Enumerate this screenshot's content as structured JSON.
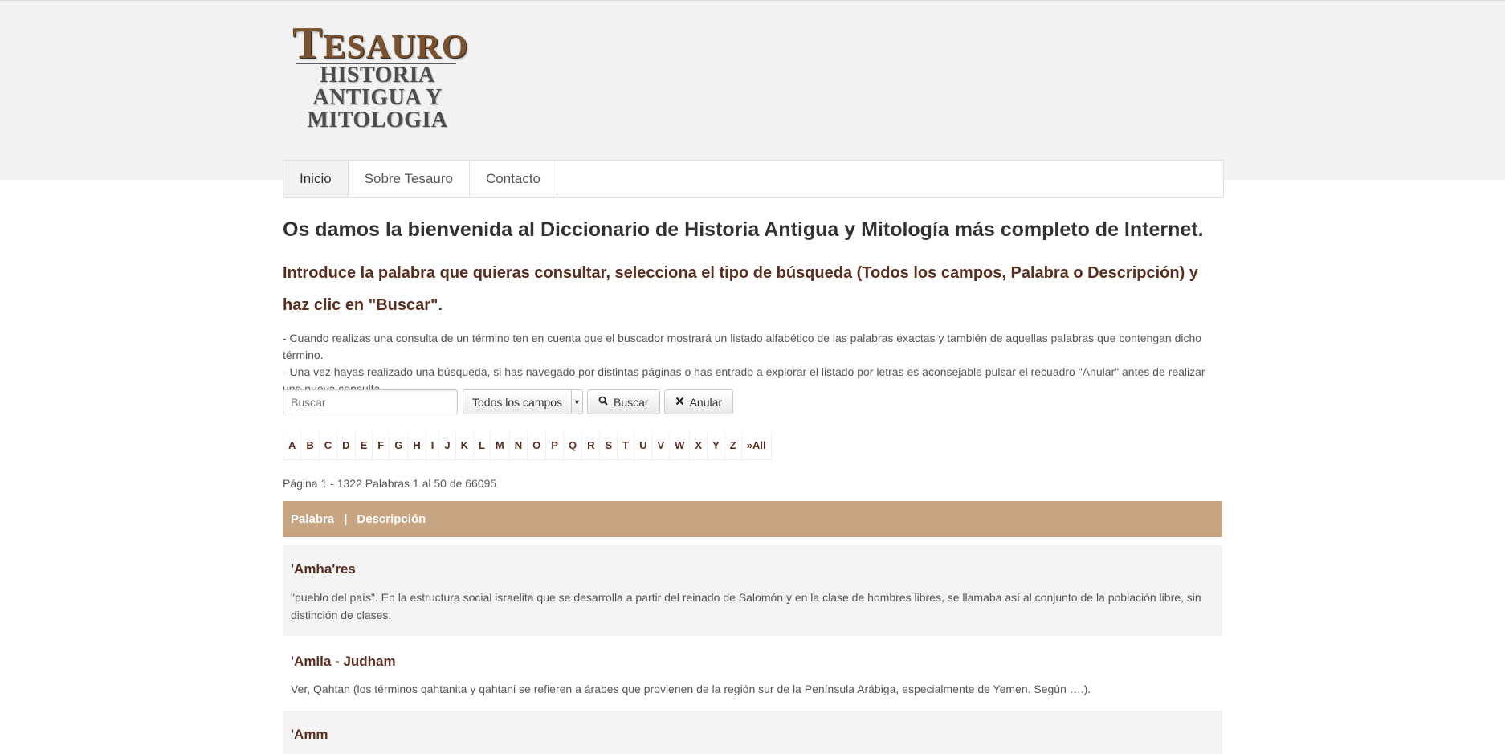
{
  "logo": {
    "line1_T": "T",
    "line1_rest": "ESAURO",
    "line2": "HISTORIA",
    "line3": "ANTIGUA Y",
    "line4": "MITOLOGIA"
  },
  "nav": {
    "items": [
      {
        "label": "Inicio"
      },
      {
        "label": "Sobre Tesauro"
      },
      {
        "label": "Contacto"
      }
    ]
  },
  "main": {
    "welcome": "Os damos la bienvenida al Diccionario de Historia Antigua y Mitología más completo de Internet.",
    "intro": "Introduce la palabra que quieras consultar, selecciona el tipo de búsqueda (Todos los campos, Palabra o Descripción) y haz clic en \"Buscar\".",
    "note1": "- Cuando realizas una consulta de un término ten en cuenta que el buscador mostrará un listado alfabético de las palabras exactas y también de aquellas palabras que contengan dicho término.",
    "note2": "- Una vez hayas realizado una búsqueda, si has navegado por distintas páginas o has entrado a explorar el listado por letras es aconsejable pulsar el recuadro \"Anular\" antes de realizar una nueva consulta."
  },
  "search": {
    "placeholder": "Buscar",
    "select_value": "Todos los campos",
    "search_button": "Buscar",
    "clear_button": "Anular"
  },
  "letters": [
    "A",
    "B",
    "C",
    "D",
    "E",
    "F",
    "G",
    "H",
    "I",
    "J",
    "K",
    "L",
    "M",
    "N",
    "O",
    "P",
    "Q",
    "R",
    "S",
    "T",
    "U",
    "V",
    "W",
    "X",
    "Y",
    "Z",
    "»All"
  ],
  "page_info": "Página 1 - 1322 Palabras 1 al 50 de 66095",
  "table": {
    "col_word": "Palabra",
    "separator": "|",
    "col_desc": "Descripción"
  },
  "entries": [
    {
      "term": "'Amha'res",
      "description": "\"pueblo del país\". En la estructura social israelita que se desarrolla a partir del reinado de Salomón y en la clase de hombres libres, se llamaba así al conjunto de la población libre, sin distinción de clases."
    },
    {
      "term": "'Amila - Judham",
      "description": "Ver, Qahtan (los términos qahtanita y qahtani se refieren a árabes que provienen de la región sur de la Península Arábiga, especialmente de Yemen. Según ….)."
    },
    {
      "term": "'Amm",
      "description": ""
    }
  ]
}
